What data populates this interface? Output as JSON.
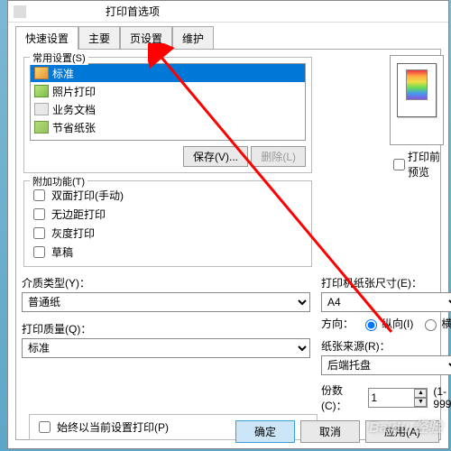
{
  "window": {
    "title": "打印首选项"
  },
  "tabs": {
    "quick": "快速设置",
    "main": "主要",
    "page": "页设置",
    "maint": "维护"
  },
  "presets": {
    "label": "常用设置(S)",
    "items": [
      {
        "label": "标准"
      },
      {
        "label": "照片打印"
      },
      {
        "label": "业务文档"
      },
      {
        "label": "节省纸张"
      }
    ],
    "save_btn": "保存(V)...",
    "delete_btn": "删除(L)"
  },
  "preview_chk": "打印前预览",
  "addfunc": {
    "label": "附加功能(T)",
    "duplex": "双面打印(手动)",
    "borderless": "无边距打印",
    "gray": "灰度打印",
    "draft": "草稿"
  },
  "media": {
    "type_label": "介质类型(Y)：",
    "type_value": "普通纸",
    "quality_label": "打印质量(Q)：",
    "quality_value": "标准"
  },
  "paper": {
    "size_label": "打印机纸张尺寸(E)：",
    "size_value": "A4",
    "orient_label": "方向：",
    "portrait": "纵向(I)",
    "landscape": "横",
    "source_label": "纸张来源(R)：",
    "source_value": "后端托盘",
    "copies_label": "份数(C)：",
    "copies_value": "1",
    "copies_range": "(1-999"
  },
  "always_chk": "始终以当前设置打印(P)",
  "buttons": {
    "ok": "确定",
    "cancel": "取消",
    "apply": "应用(A)"
  }
}
